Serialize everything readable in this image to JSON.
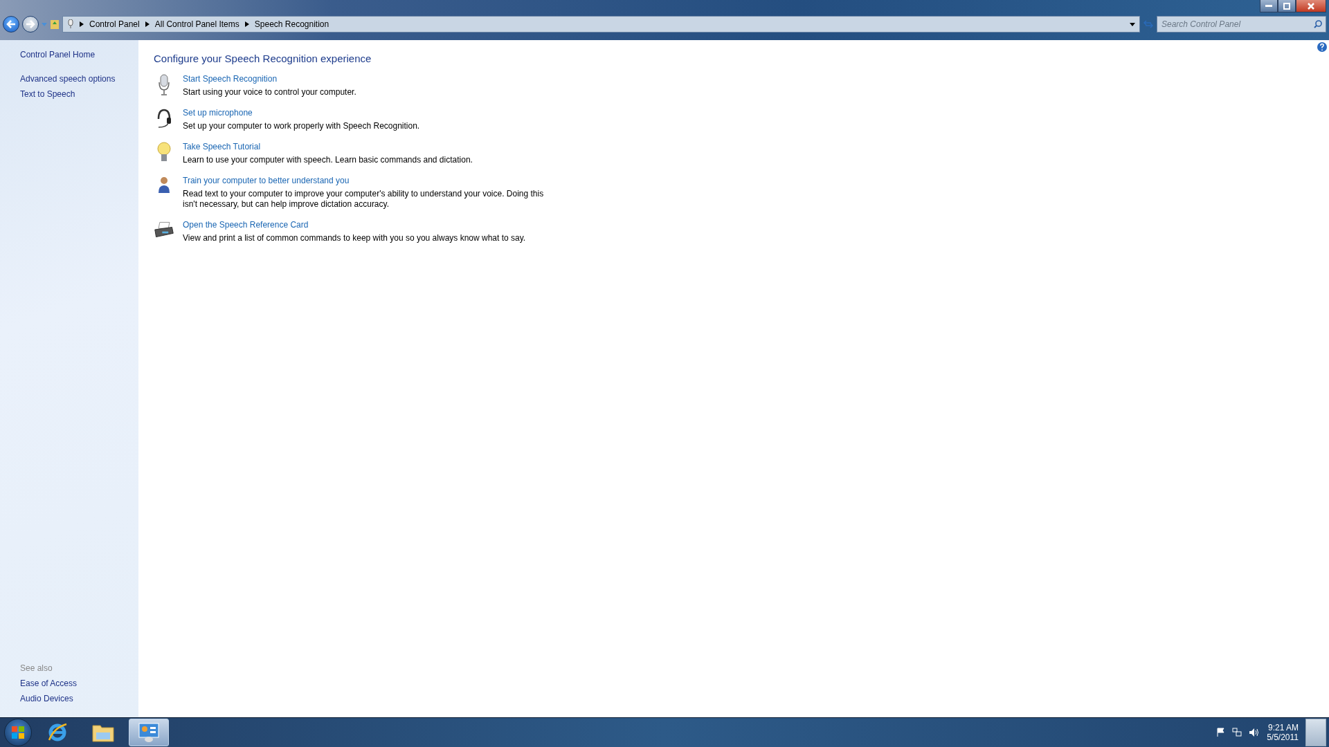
{
  "address_bar": {
    "breadcrumbs": [
      "Control Panel",
      "All Control Panel Items",
      "Speech Recognition"
    ]
  },
  "search": {
    "placeholder": "Search Control Panel"
  },
  "sidebar": {
    "items": [
      {
        "label": "Control Panel Home",
        "kind": "home"
      },
      {
        "label": "Advanced speech options",
        "kind": "task"
      },
      {
        "label": "Text to Speech",
        "kind": "task"
      }
    ],
    "see_also": {
      "title": "See also",
      "items": [
        "Ease of Access",
        "Audio Devices"
      ]
    }
  },
  "content": {
    "title": "Configure your Speech Recognition experience",
    "tasks": [
      {
        "kind": "microphone",
        "link": "Start Speech Recognition",
        "description": "Start using your voice to control your computer."
      },
      {
        "kind": "headset",
        "link": "Set up microphone",
        "description": "Set up your computer to work properly with Speech Recognition."
      },
      {
        "kind": "bulb",
        "link": "Take Speech Tutorial",
        "description": "Learn to use your computer with speech.  Learn basic commands and dictation."
      },
      {
        "kind": "person",
        "link": "Train your computer to better understand you",
        "description": "Read text to your computer to improve your computer's ability to understand your voice.  Doing this isn't necessary, but can help improve dictation accuracy."
      },
      {
        "kind": "printer",
        "link": "Open the Speech Reference Card",
        "description": "View and print a list of common commands to keep with you so you always know what to say."
      }
    ]
  },
  "taskbar": {
    "apps": [
      {
        "kind": "ie",
        "selected": false
      },
      {
        "kind": "folder",
        "selected": false
      },
      {
        "kind": "control-panel",
        "selected": true
      }
    ],
    "clock": {
      "time": "9:21 AM",
      "date": "5/5/2011"
    }
  }
}
